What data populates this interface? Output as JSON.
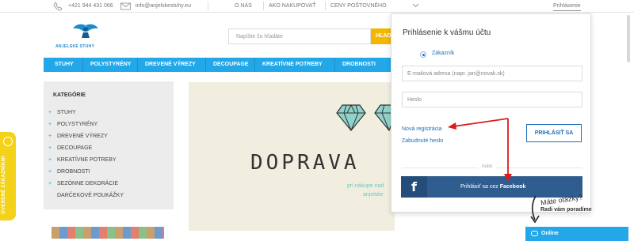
{
  "topbar": {
    "phone": "+421 944 431 066",
    "email": "info@anjelskestuhy.eu",
    "links": [
      "O NÁS",
      "AKO NAKUPOVAŤ",
      "CENY POŠTOVNÉHO"
    ],
    "login": "Prihlásenie",
    "phone_icon": "phone-icon",
    "email_icon": "envelope-icon"
  },
  "logo": {
    "text": "ANJELSKÉ STUHY"
  },
  "search": {
    "placeholder": "Napíšte čo hľadáte",
    "button": "HĽADAŤ"
  },
  "nav": [
    "STUHY",
    "POLYSTYRÉNY",
    "DREVENÉ VÝREZY",
    "DECOUPAGE",
    "KREATÍVNE POTREBY",
    "DROBNOSTI"
  ],
  "sidebar": {
    "title": "KATEGÓRIE",
    "items": [
      "STUHY",
      "POLYSTYRÉNY",
      "DREVENÉ VÝREZY",
      "DECOUPAGE",
      "KREATÍVNE POTREBY",
      "DROBNOSTI",
      "SEZÓNNE DEKORÁCIE",
      "DARČEKOVÉ POUKÁŽKY"
    ]
  },
  "banner": {
    "title": "DOPRAVA",
    "sub1": "pri nákupe nad",
    "sub2": "anjelske"
  },
  "badge": {
    "label": "OVERENÉ ZÁKAZNÍKMI"
  },
  "modal": {
    "title": "Prihlásenie k vášmu účtu",
    "radio": "Zákazník",
    "email_placeholder": "E-mailová adresa (napr. jan@novak.sk)",
    "password_placeholder": "Heslo",
    "register": "Nová registrácia",
    "forgot": "Zabudnuté heslo",
    "login_button": "PRIHLÁSIŤ SA",
    "divider": "nebo",
    "fb_prefix": "Prihlásiť sa cez",
    "fb_name": "Facebook"
  },
  "chat": {
    "question": "Máte otázky?",
    "help": "Radi vám poradíme",
    "button": "Online"
  },
  "colors": {
    "accent": "#22a7e8",
    "link": "#1f6fb8",
    "facebook": "#2f5d8f",
    "search_button": "#f3b700",
    "badge": "#f3d219",
    "arrow": "#e0191b"
  }
}
